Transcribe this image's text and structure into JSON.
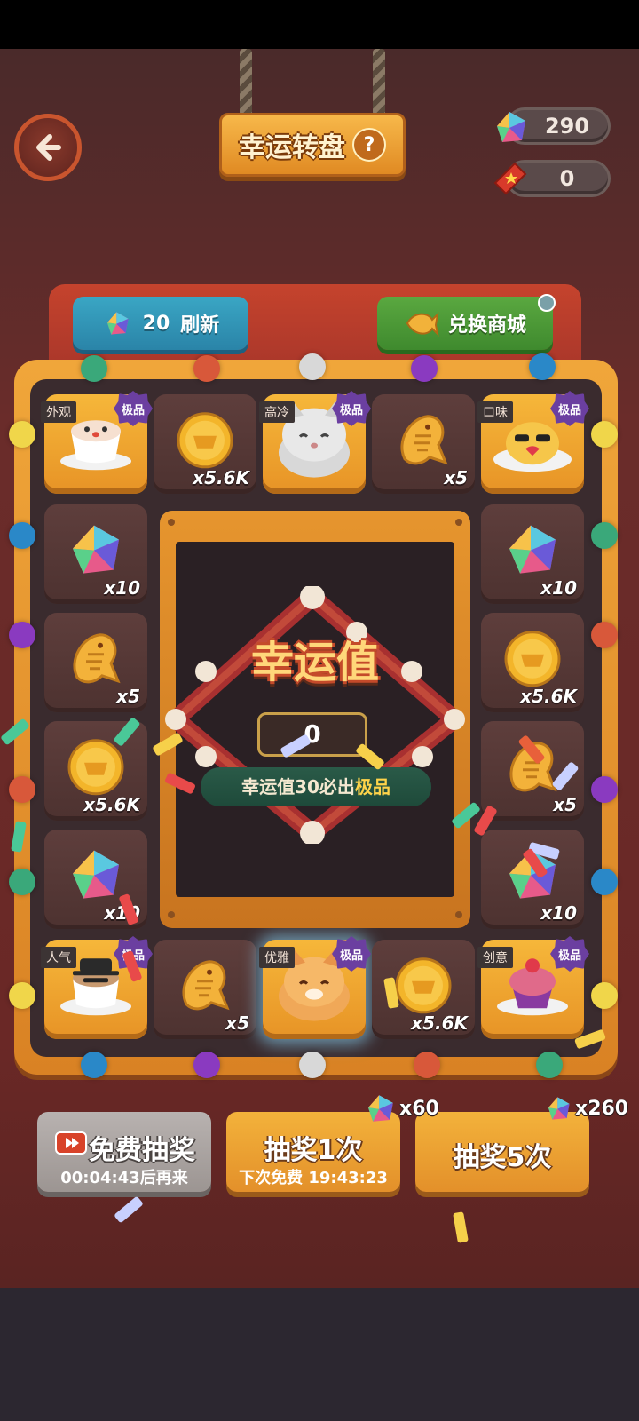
{
  "header": {
    "title": "幸运转盘",
    "help": "?",
    "gems": "290",
    "tickets": "0"
  },
  "board": {
    "refresh_cost": "20",
    "refresh_label": "刷新",
    "shop_label": "兑换商城",
    "premium_label": "极品",
    "cells": {
      "c0": {
        "tag": "外观",
        "qty": ""
      },
      "c1": {
        "qty": "x5.6K"
      },
      "c2": {
        "tag": "高冷",
        "qty": ""
      },
      "c3": {
        "qty": "x5"
      },
      "c4": {
        "tag": "口味",
        "qty": ""
      },
      "c5": {
        "qty": "x10"
      },
      "c6": {
        "qty": "x10"
      },
      "c7": {
        "qty": "x5"
      },
      "c8": {
        "qty": "x5.6K"
      },
      "c9": {
        "qty": "x5.6K"
      },
      "c10": {
        "qty": "x5"
      },
      "c11": {
        "qty": "x10"
      },
      "c12": {
        "qty": "x10"
      },
      "c13": {
        "tag": "人气",
        "qty": ""
      },
      "c14": {
        "qty": "x5"
      },
      "c15": {
        "tag": "优雅",
        "qty": ""
      },
      "c16": {
        "qty": "x5.6K"
      },
      "c17": {
        "tag": "创意",
        "qty": ""
      }
    }
  },
  "luck": {
    "title": "幸运值",
    "value": "0",
    "banner_prefix": "幸运值30必出",
    "banner_highlight": "极品"
  },
  "actions": {
    "free_label": "免费抽奖",
    "free_timer": "00:04:43后再来",
    "draw1_label": "抽奖1次",
    "draw1_sub": "下次免费 19:43:23",
    "draw1_cost": "x60",
    "draw5_label": "抽奖5次",
    "draw5_cost": "x260"
  },
  "colors": {
    "gold_cell": "#f6b73a",
    "dark_cell": "#5e3e3c",
    "frame": "#f0a63a",
    "refresh_button": "#3aa6c4",
    "shop_button": "#5aa840"
  }
}
